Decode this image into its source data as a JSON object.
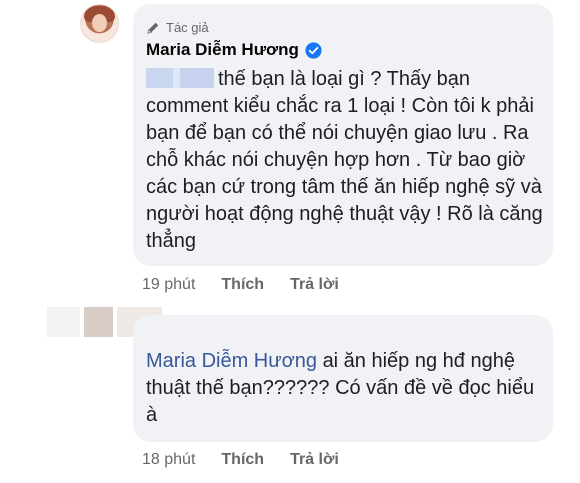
{
  "comment_main": {
    "author_badge": "Tác giả",
    "author_name": "Maria Diễm Hương",
    "mention_blurred": "",
    "text": "thế bạn là loại gì ? Thấy bạn comment kiểu chắc ra 1 loại ! Còn tôi k phải bạn để bạn có thể nói chuyện giao lưu . Ra chỗ khác nói chuyện hợp hơn . Từ bao giờ các bạn cứ trong tâm thế ăn hiếp nghệ sỹ và người hoạt động nghệ thuật vậy ! Rõ là căng thẳng",
    "time": "19 phút",
    "like_label": "Thích",
    "reply_label": "Trả lời"
  },
  "comment_reply": {
    "mention": "Maria Diễm Hương",
    "text": "ai ăn hiếp ng hđ nghệ thuật thế bạn?????? Có vấn đề về đọc hiểu à",
    "time": "18 phút",
    "like_label": "Thích",
    "reply_label": "Trả lời"
  },
  "icons": {
    "author_icon": "pen-icon",
    "verified_icon": "verified-badge-icon"
  },
  "colors": {
    "bubble_bg": "#f0f2f5",
    "meta_text": "#65676b",
    "mention_link": "#385898",
    "verified_blue": "#1877f2"
  }
}
